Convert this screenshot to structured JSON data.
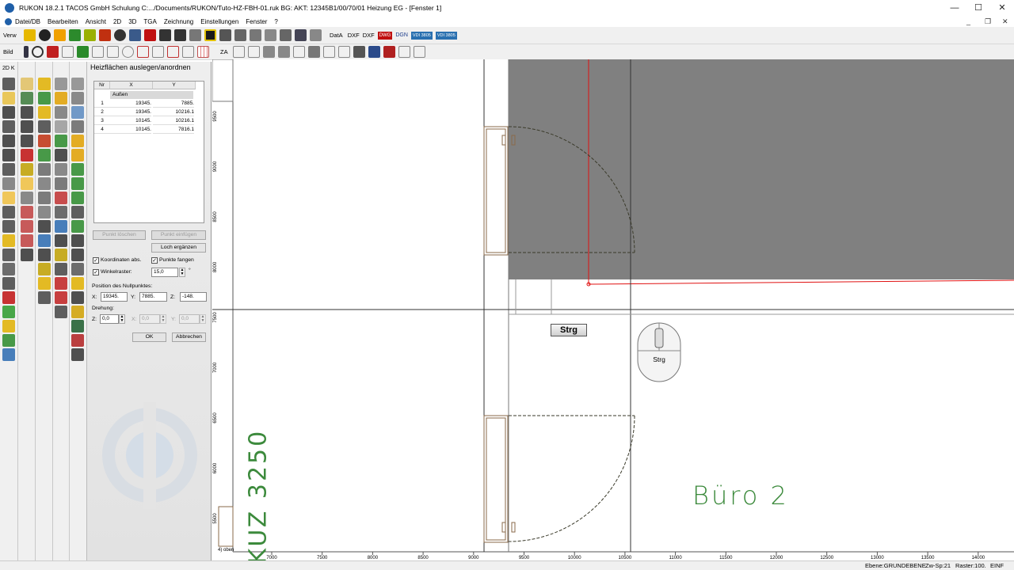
{
  "window": {
    "title": "RUKON 18.2.1  TACOS GmbH Schulung     C:.../Documents/RUKON/Tuto-HZ-FBH-01.ruk  BG:  AKT: 12345B1/00/70/01 Heizung EG - [Fenster 1]",
    "minimize": "—",
    "maximize": "☐",
    "close": "✕"
  },
  "menu": [
    "Datei/DB",
    "Bearbeiten",
    "Ansicht",
    "2D",
    "3D",
    "TGA",
    "Zeichnung",
    "Einstellungen",
    "Fenster",
    "?"
  ],
  "mdi_controls": [
    "_",
    "❐",
    "✕"
  ],
  "toolbars": {
    "row1_label": "Verw",
    "row2_label": "Bild",
    "data_label": "DatA",
    "za_label": "ZA",
    "dxf1": "DXF",
    "dxf2": "DXF",
    "dwg": "DWG",
    "dgn": "DGN",
    "vdi1": "VDI 3805",
    "vdi2": "VDI 3805",
    "mode": "2D K"
  },
  "dialog": {
    "title": "Heizflächen auslegen/anordnen",
    "table": {
      "headers": [
        "Nr",
        "X",
        "Y"
      ],
      "group": "Außen",
      "rows": [
        {
          "nr": "1",
          "x": "19345.",
          "y": "7885."
        },
        {
          "nr": "2",
          "x": "19345.",
          "y": "10216.1"
        },
        {
          "nr": "3",
          "x": "10145.",
          "y": "10216.1"
        },
        {
          "nr": "4",
          "x": "10145.",
          "y": "7816.1"
        }
      ]
    },
    "btn_delete_point": "Punkt löschen",
    "btn_insert_point": "Punkt einfügen",
    "btn_add_hole": "Loch ergänzen",
    "cb_coords_abs": "Koordinaten abs.",
    "cb_snap_points": "Punkte fangen",
    "cb_angle_grid": "Winkelraster:",
    "angle_value": "15,0",
    "angle_unit": "°",
    "origin_label": "Position des Nullpunktes:",
    "x_label": "X:",
    "y_label": "Y:",
    "z_label": "Z:",
    "origin_x": "19345.",
    "origin_y": "7885.",
    "origin_z": "-148.",
    "rotation_label": "Drehung:",
    "rot_z": "0,0",
    "rot_x": "0,0",
    "rot_y": "0,0",
    "ok": "OK",
    "cancel": "Abbrechen"
  },
  "canvas": {
    "strg_key": "Strg",
    "mouse_label": "Strg",
    "room_label": "Büro 2",
    "kuz_label": "KUZ 3250",
    "corner_label": "4) oben",
    "x_ticks": [
      "7000",
      "7500",
      "8000",
      "8500",
      "9000",
      "9500",
      "10000",
      "10500",
      "11000",
      "11500",
      "12000",
      "12500",
      "13000",
      "13500",
      "14000"
    ],
    "y_ticks": [
      "9500",
      "9000",
      "8500",
      "8000",
      "7500",
      "7000",
      "6500",
      "6000",
      "5500"
    ]
  },
  "status": {
    "layer": "Ebene:GRUNDEBENE",
    "zw": "Zw-Sp:21",
    "raster": "Raster:100.",
    "mode": "EINF"
  },
  "colors": {
    "wall_gray": "#808080",
    "door_brown": "#8a6a4a",
    "room_text": "#3c8a3c",
    "red_line": "#e01010"
  }
}
